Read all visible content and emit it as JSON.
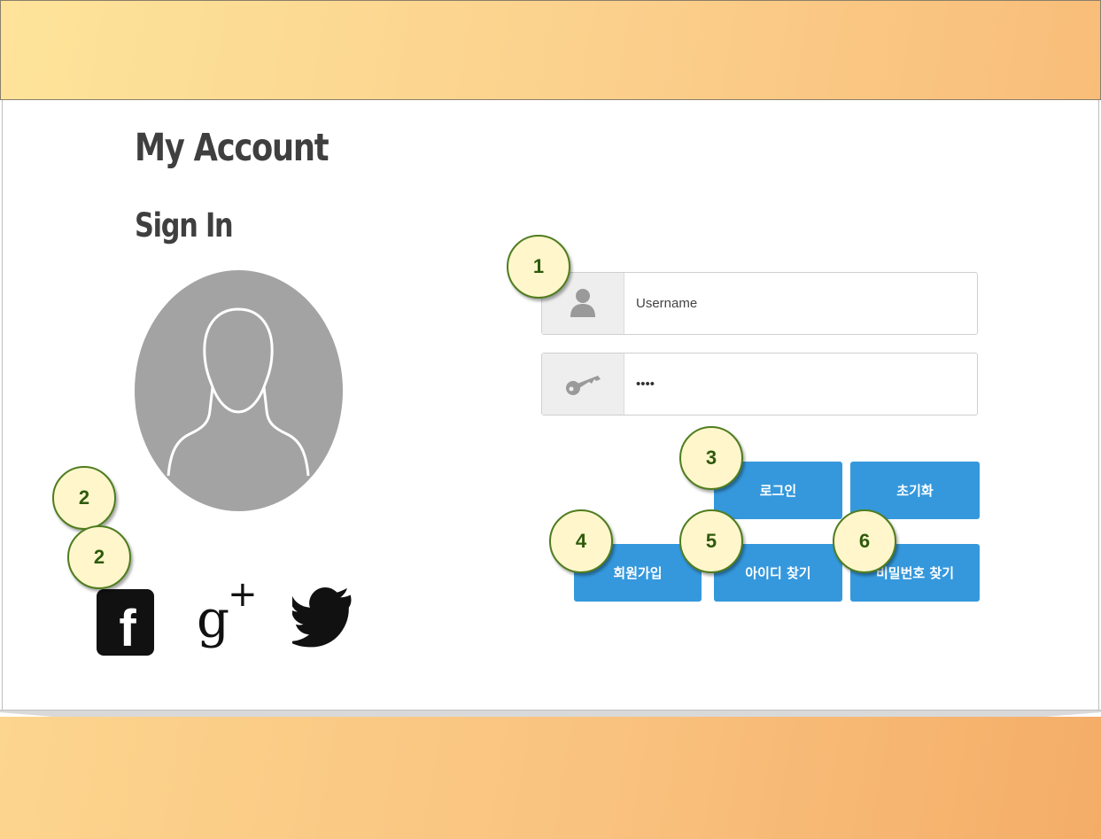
{
  "page": {
    "title": "My Account",
    "subtitle": "Sign In"
  },
  "form": {
    "username": {
      "placeholder": "Username",
      "value": ""
    },
    "password": {
      "value": "aaaa"
    }
  },
  "buttons": {
    "login": "로그인",
    "reset": "초기화",
    "join": "회원가입",
    "find_id": "아이디 찾기",
    "find_password": "비밀번호 찾기"
  },
  "social": {
    "facebook_label": "f",
    "googleplus_label": "g",
    "googleplus_plus": "+"
  },
  "annotations": [
    "1",
    "2",
    "2",
    "3",
    "4",
    "5",
    "6"
  ],
  "colors": {
    "button": "#3598dc",
    "badge_fill": "#fff6cc",
    "badge_border": "#4f7d1f",
    "avatar": "#a3a3a3"
  },
  "icons": [
    "user-icon",
    "key-icon",
    "avatar-silhouette-icon",
    "facebook-icon",
    "googleplus-icon",
    "twitter-icon"
  ]
}
